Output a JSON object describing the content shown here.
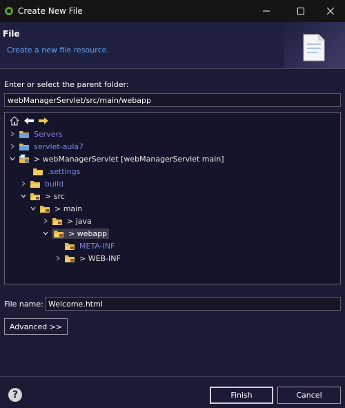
{
  "window": {
    "title": "Create New File",
    "min_label": "—",
    "max_label": "☐",
    "close_label": "✕"
  },
  "header": {
    "title": "File",
    "subtitle": "Create a new file resource."
  },
  "parent_folder": {
    "label": "Enter or select the parent folder:",
    "value": "webManagerServlet/src/main/webapp"
  },
  "tree": {
    "toolbar": [
      "home-icon",
      "back-arrow-icon",
      "forward-arrow-icon"
    ],
    "nodes": [
      {
        "label": "Servers",
        "icon": "folder-icon",
        "color": "#7b86e0",
        "expanded": false
      },
      {
        "label": "servlet-aula7",
        "icon": "folder-icon",
        "color": "#7b86e0",
        "expanded": false
      },
      {
        "label": "> webManagerServlet [webManagerServlet main]",
        "icon": "project-icon",
        "color": "#e8e8e8",
        "expanded": true
      },
      {
        "label": ".settings",
        "icon": "folder-icon",
        "color": "#7b86e0"
      },
      {
        "label": "build",
        "icon": "folder-icon",
        "color": "#7b86e0",
        "expanded": false
      },
      {
        "label": "> src",
        "icon": "package-folder-icon",
        "color": "#e8e8e8",
        "expanded": true
      },
      {
        "label": "> main",
        "icon": "package-folder-icon",
        "color": "#e8e8e8",
        "expanded": true
      },
      {
        "label": "> java",
        "icon": "package-folder-icon",
        "color": "#e8e8e8",
        "expanded": false
      },
      {
        "label": "> webapp",
        "icon": "package-folder-icon",
        "color": "#ffffff",
        "expanded": true,
        "selected": true
      },
      {
        "label": "META-INF",
        "icon": "package-folder-icon",
        "color": "#7b86e0"
      },
      {
        "label": "> WEB-INF",
        "icon": "package-folder-icon",
        "color": "#e8e8e8",
        "expanded": false
      }
    ]
  },
  "file_name": {
    "label": "File name:",
    "value": "Welcome.html"
  },
  "buttons": {
    "advanced": "Advanced >>",
    "finish": "Finish",
    "cancel": "Cancel",
    "help": "?"
  },
  "colors": {
    "background": "#1b1b35",
    "accent": "#6aa6f2",
    "folder_label": "#7b86e0",
    "selection": "#3a3a4e"
  }
}
